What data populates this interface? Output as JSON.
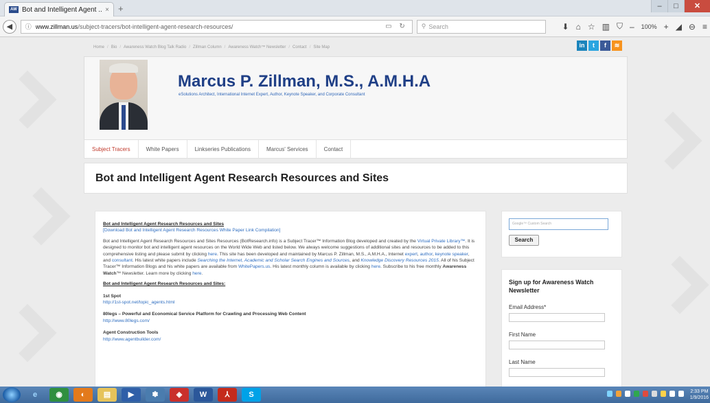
{
  "browser": {
    "tab_title": "Bot and Intelligent Agent ...",
    "tab_favicon": "AW",
    "tab_close": "×",
    "new_tab": "+",
    "url_host": "www.zillman.us",
    "url_path": "/subject-tracers/bot-intelligent-agent-research-resources/",
    "search_placeholder": "Search",
    "zoom_level": "100%",
    "window_controls": {
      "minimize": "–",
      "maximize": "□",
      "close": "✕"
    }
  },
  "site": {
    "top_nav": [
      "Home",
      "Bio",
      "Awareness Watch Blog Talk Radio",
      "Zillman Column",
      "Awareness Watch™ Newsletter",
      "Contact",
      "Site Map"
    ],
    "social": {
      "linkedin": "in",
      "twitter": "t",
      "facebook": "f",
      "rss": "≋"
    },
    "name": "Marcus P. Zillman, M.S., A.M.H.A",
    "tagline": "eSolutions Architect, International Internet Expert, Author, Keynote Speaker, and Corporate Consultant",
    "menu": [
      "Subject Tracers",
      "White Papers",
      "Linkseries Publications",
      "Marcus' Services",
      "Contact"
    ],
    "page_title": "Bot and Intelligent Agent Research Resources and Sites"
  },
  "content": {
    "heading": "Bot and Intelligent Agent Research Resources and Sites",
    "download_link": "[Download Bot and Intelligent Agent Research Resources White Paper Link Compilation]",
    "intro_1": "Bot and Intelligent Agent Research Resources and Sites Resources (BotResearch.info) is a Subject Tracer™ Information Blog developed and created by the ",
    "intro_link_vpl": "Virtual Private Library™",
    "intro_2": ". It is designed to monitor bot and intelligent agent resources on the World Wide Web and listed below. We always welcome suggestions of additional sites and resources to be added to this comprehensive listing and please submit by clicking ",
    "intro_link_here": "here",
    "intro_3": ". This site has been developed and maintained by Marcus P. Zillman, M.S., A.M.H.A., Internet ",
    "intro_link_expert": "expert",
    "intro_link_author": "author",
    "intro_link_speaker": "keynote speaker",
    "intro_link_consultant": "consultant",
    "intro_4": ". His latest white papers include ",
    "wp_1": "Searching the Internet, Academic and Scholar Search Engines and Sources",
    "intro_5": ", and ",
    "wp_2": "Knowledge Discovery Resources 2015",
    "intro_6": ". All of his Subject Tracer™ Information Blogs and his white papers are available from ",
    "intro_link_wp": "WhitePapers.us",
    "intro_7": ". His latest monthly column is available by clicking ",
    "intro_8": ". Subscribe to his free monthly ",
    "newsletter_name": "Awareness Watch",
    "intro_9": "™ Newsletter. Learn more by clicking ",
    "section_heading": "Bot and Intelligent Agent Research Resources and Sites:",
    "entries": [
      {
        "title": "1st Spot",
        "url": "http://1st-spot.net/topic_agents.html"
      },
      {
        "title": "80legs – Powerful and Economical Service Platform for Crawling and Processing Web Content",
        "url": "http://www.80legs.com/"
      },
      {
        "title": "Agent Construction Tools",
        "url": "http://www.agentbuilder.com/"
      }
    ]
  },
  "sidebar": {
    "search_placeholder": "Google™ Custom Search",
    "search_button": "Search",
    "signup_title": "Sign up for Awareness Watch Newsletter",
    "email_label": "Email Address*",
    "first_name_label": "First Name",
    "last_name_label": "Last Name"
  },
  "taskbar": {
    "icons": [
      "e",
      "◉",
      "◐",
      "▤",
      "▶",
      "✽",
      "◈",
      "W",
      "⅄",
      "S"
    ],
    "time": "2:33 PM",
    "date": "1/9/2016"
  }
}
